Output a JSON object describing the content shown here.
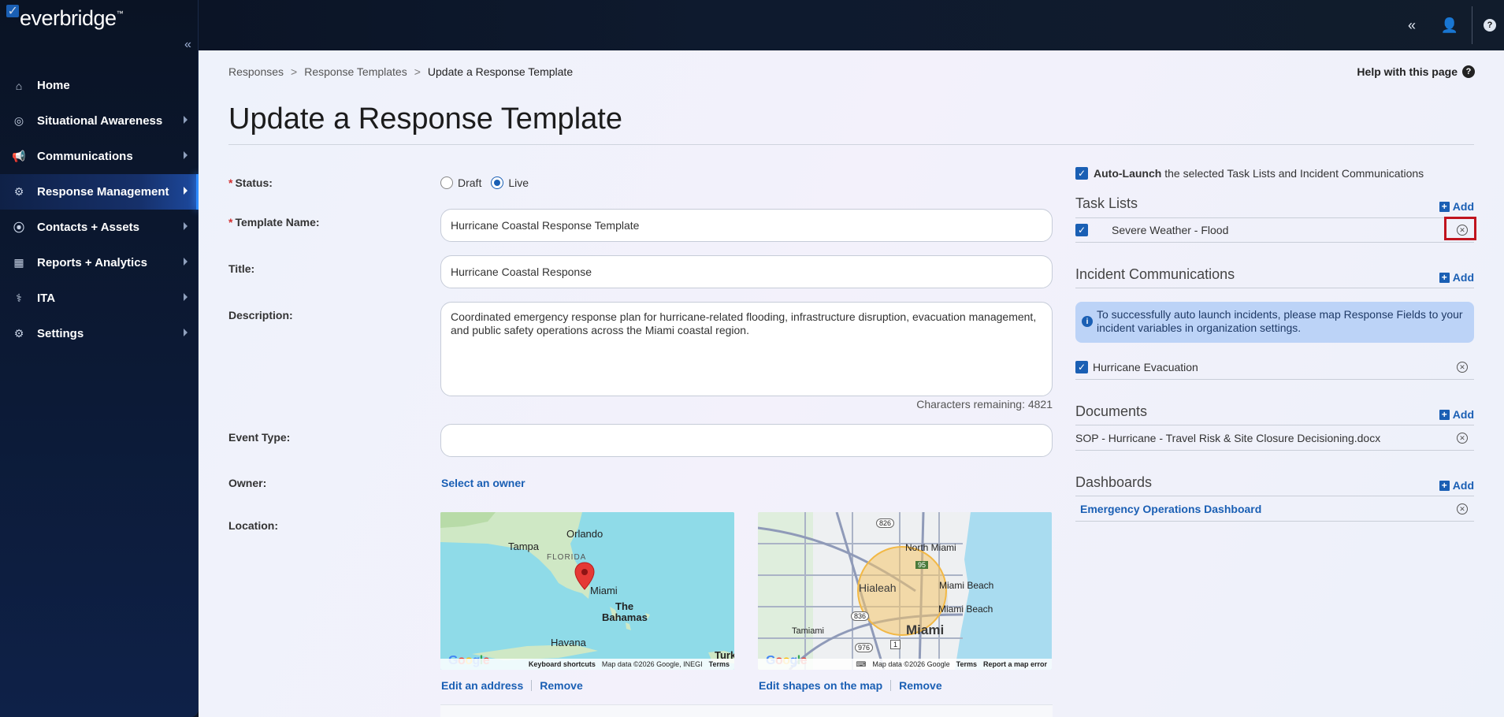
{
  "app": {
    "logo": "everbridge",
    "logo_tm": "™"
  },
  "topbar": {
    "collapse_glyph": "«",
    "user_glyph": "👤",
    "help_glyph": "?"
  },
  "sidebar": {
    "collapse_glyph": "«",
    "items": [
      {
        "label": "Home",
        "icon": "home-icon",
        "glyph": "⌂",
        "has_arrow": false
      },
      {
        "label": "Situational Awareness",
        "icon": "radar-icon",
        "glyph": "◎",
        "has_arrow": true
      },
      {
        "label": "Communications",
        "icon": "megaphone-icon",
        "glyph": "📢",
        "has_arrow": true
      },
      {
        "label": "Response Management",
        "icon": "workflow-icon",
        "glyph": "⚙",
        "has_arrow": true,
        "active": true
      },
      {
        "label": "Contacts + Assets",
        "icon": "location-pin-icon",
        "glyph": "⦿",
        "has_arrow": true
      },
      {
        "label": "Reports + Analytics",
        "icon": "bar-chart-icon",
        "glyph": "▦",
        "has_arrow": true
      },
      {
        "label": "ITA",
        "icon": "ita-icon",
        "glyph": "⚕",
        "has_arrow": true
      },
      {
        "label": "Settings",
        "icon": "gear-icon",
        "glyph": "⚙",
        "has_arrow": true
      }
    ]
  },
  "breadcrumb": {
    "items": [
      "Responses",
      "Response Templates",
      "Update a Response Template"
    ],
    "separator": ">"
  },
  "help": {
    "label": "Help with this page"
  },
  "page": {
    "title": "Update a Response Template"
  },
  "form": {
    "status": {
      "label": "Status:",
      "required_mark": "*",
      "options": [
        "Draft",
        "Live"
      ],
      "selected": "Live"
    },
    "template_name": {
      "label": "Template Name:",
      "required_mark": "*",
      "value": "Hurricane Coastal Response Template"
    },
    "title": {
      "label": "Title:",
      "value": "Hurricane Coastal Response"
    },
    "description": {
      "label": "Description:",
      "value": "Coordinated emergency response plan for hurricane-related flooding, infrastructure disruption, evacuation management, and public safety operations across the Miami coastal region.",
      "chars_remaining": "Characters remaining: 4821"
    },
    "event_type": {
      "label": "Event Type:",
      "value": ""
    },
    "owner": {
      "label": "Owner:",
      "link": "Select an owner"
    },
    "location": {
      "label": "Location:",
      "map1": {
        "labels": [
          "Orlando",
          "Tampa",
          "FLORIDA",
          "Miami",
          "The",
          "Bahamas",
          "Havana",
          "Turk"
        ],
        "footer": [
          "Keyboard shortcuts",
          "Map data ©2026 Google, INEGI",
          "Terms"
        ],
        "links": [
          "Edit an address",
          "Remove"
        ]
      },
      "map2": {
        "labels": [
          "North Miami",
          "Hialeah",
          "Miami Beach",
          "Miami Beach",
          "Tamiami",
          "Miami",
          "826",
          "836",
          "976",
          "1",
          "95"
        ],
        "footer": [
          "Map data ©2026 Google",
          "Terms",
          "Report a map error"
        ],
        "links": [
          "Edit shapes on the map",
          "Remove"
        ]
      },
      "google": "Google"
    }
  },
  "right": {
    "auto_launch": {
      "bold": "Auto-Launch",
      "rest": " the selected Task Lists and Incident Communications",
      "checked": true
    },
    "task_lists": {
      "title": "Task Lists",
      "add": "Add",
      "items": [
        "Severe Weather - Flood"
      ]
    },
    "incident_comms": {
      "title": "Incident Communications",
      "add": "Add",
      "info": "To successfully auto launch incidents, please map Response Fields to your incident variables in organization settings.",
      "items": [
        "Hurricane Evacuation"
      ]
    },
    "documents": {
      "title": "Documents",
      "add": "Add",
      "items": [
        "SOP - Hurricane - Travel Risk & Site Closure Decisioning.docx"
      ]
    },
    "dashboards": {
      "title": "Dashboards",
      "add": "Add",
      "items": [
        "Emergency Operations Dashboard"
      ]
    }
  }
}
